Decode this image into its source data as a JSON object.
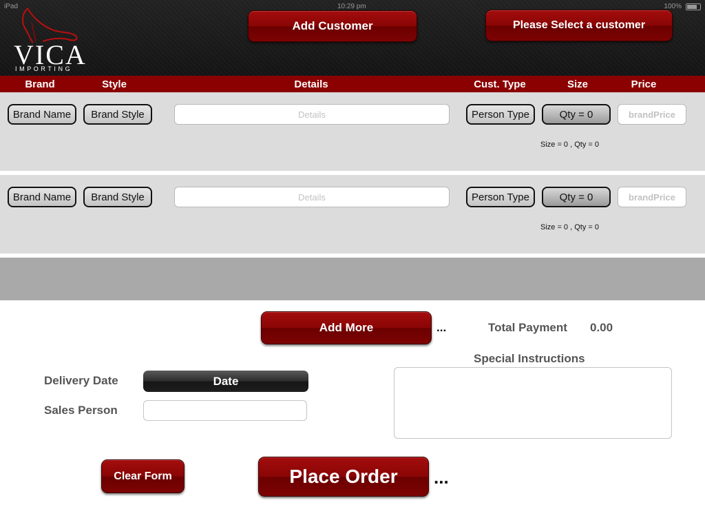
{
  "status_bar": {
    "left": "iPad",
    "time": "10:29 pm",
    "battery": "100%"
  },
  "logo": {
    "name": "VICA",
    "tagline": "IMPORTING"
  },
  "header_buttons": {
    "add_customer": "Add Customer",
    "select_customer": "Please Select a customer"
  },
  "columns": [
    "Brand",
    "Style",
    "Details",
    "Cust. Type",
    "Size",
    "Price"
  ],
  "rows": [
    {
      "brand": "Brand Name",
      "style": "Brand Style",
      "details_placeholder": "Details",
      "person_type": "Person Type",
      "qty": "Qty = 0",
      "price_placeholder": "brandPrice",
      "size_info": "Size = 0 , Qty = 0"
    },
    {
      "brand": "Brand Name",
      "style": "Brand Style",
      "details_placeholder": "Details",
      "person_type": "Person Type",
      "qty": "Qty = 0",
      "price_placeholder": "brandPrice",
      "size_info": "Size = 0 , Qty = 0"
    }
  ],
  "footer": {
    "add_more": "Add More",
    "ellipsis": "...",
    "total_label": "Total Payment",
    "total_value": "0.00",
    "special_instructions_label": "Special Instructions",
    "delivery_date_label": "Delivery Date",
    "date_button": "Date",
    "sales_person_label": "Sales Person",
    "clear_form": "Clear Form",
    "place_order": "Place Order"
  },
  "colors": {
    "brand_red": "#8b0000",
    "header_dark": "#1a1a1a",
    "row_gray": "#dcdcdc",
    "band_gray": "#a9a9a9"
  }
}
